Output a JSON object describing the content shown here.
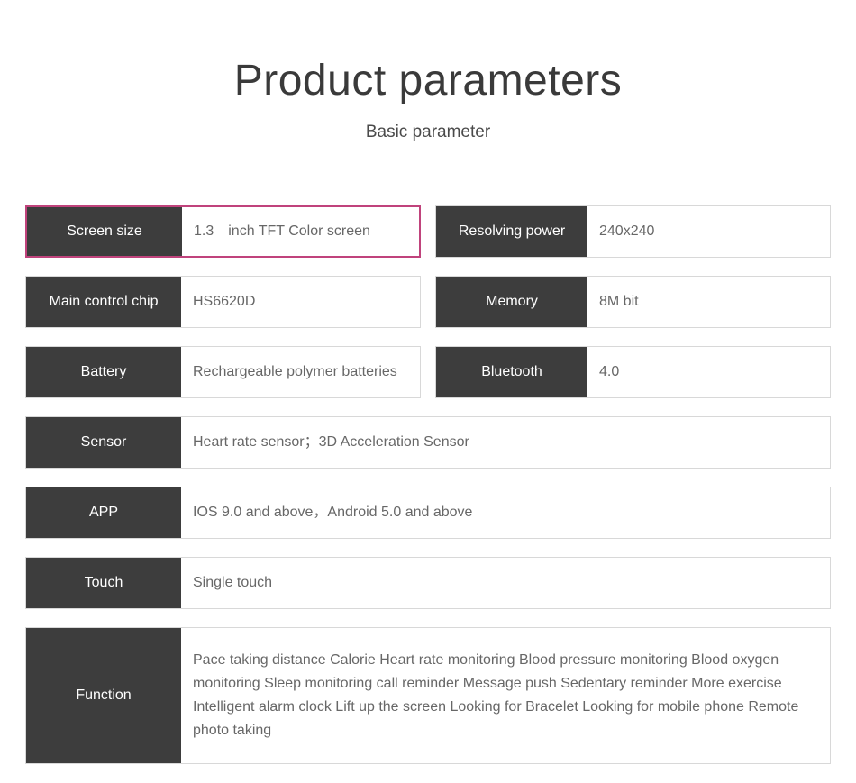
{
  "header": {
    "title": "Product parameters",
    "subtitle": "Basic parameter"
  },
  "rows": {
    "screen_size": {
      "label": "Screen size",
      "value": "1.3　inch TFT Color screen"
    },
    "resolving_power": {
      "label": "Resolving power",
      "value": "240x240"
    },
    "main_control_chip": {
      "label": "Main control chip",
      "value": "HS6620D"
    },
    "memory": {
      "label": "Memory",
      "value": "8M bit"
    },
    "battery": {
      "label": "Battery",
      "value": "Rechargeable polymer batteries"
    },
    "bluetooth": {
      "label": "Bluetooth",
      "value": "4.0"
    },
    "sensor": {
      "label": "Sensor",
      "value": "Heart rate sensor；3D Acceleration Sensor"
    },
    "app": {
      "label": "APP",
      "value": "IOS 9.0 and above，Android 5.0 and above"
    },
    "touch": {
      "label": "Touch",
      "value": "Single touch"
    },
    "function": {
      "label": "Function",
      "value": "Pace taking  distance  Calorie  Heart rate monitoring  Blood pressure monitoring  Blood oxygen monitoring  Sleep monitoring  call reminder  Message push  Sedentary reminder  More exercise  Intelligent alarm clock Lift up the screen  Looking for Bracelet  Looking for mobile phone  Remote photo taking"
    }
  },
  "colors": {
    "label_cell": "#3d3d3d",
    "value_text": "#676767",
    "highlight_border": "#c0437c",
    "default_border": "#d8d8d8",
    "background": "#ffffff"
  }
}
